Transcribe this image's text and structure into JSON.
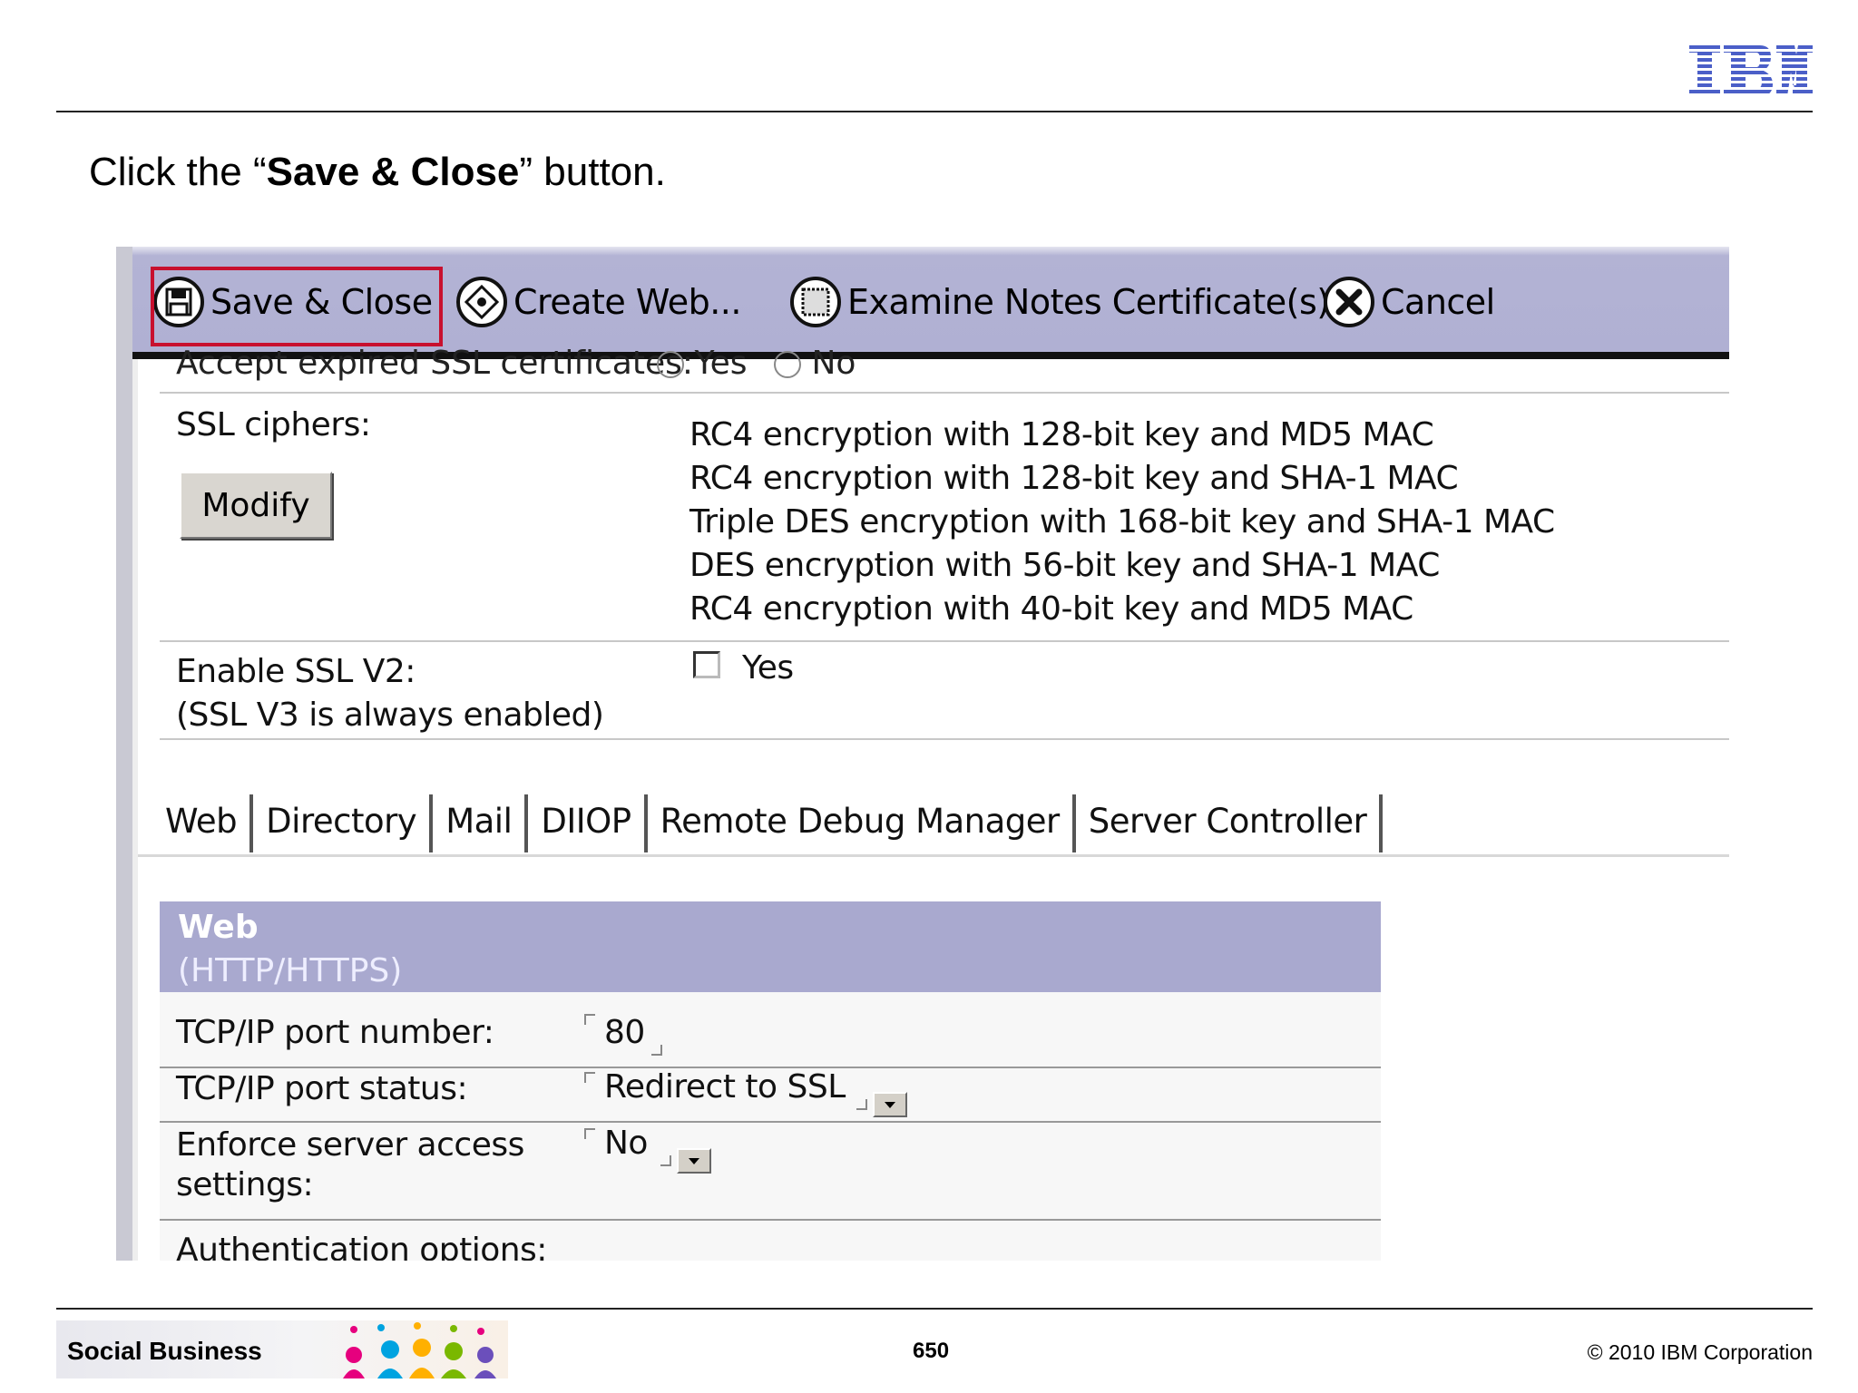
{
  "slide": {
    "instruction_prefix": "Click the “",
    "instruction_bold": "Save & Close",
    "instruction_suffix": "” button.",
    "logo_text": "IBM",
    "footer_label": "Social Business",
    "page_number": "650",
    "copyright": "© 2010 IBM Corporation"
  },
  "toolbar": {
    "buttons": [
      {
        "label": "Save & Close",
        "icon": "save-icon"
      },
      {
        "label": "Create Web...",
        "icon": "create-web-icon"
      },
      {
        "label": "Examine Notes Certificate(s)",
        "icon": "certificate-icon"
      },
      {
        "label": "Cancel",
        "icon": "cancel-icon"
      }
    ]
  },
  "form": {
    "clipped_label": "Accept expired SSL certificates:",
    "clipped_yes": "Yes",
    "clipped_no": "No",
    "ssl_ciphers_label": "SSL ciphers:",
    "modify_label": "Modify",
    "ciphers": [
      "RC4 encryption with 128-bit key and MD5 MAC",
      "RC4 encryption with 128-bit key and SHA-1 MAC",
      "Triple DES encryption with 168-bit key and SHA-1 MAC",
      "DES encryption with 56-bit key and SHA-1 MAC",
      "RC4 encryption with 40-bit key and MD5 MAC"
    ],
    "enable_ssl_v2_label": "Enable SSL V2:",
    "enable_ssl_v2_note": "(SSL V3 is always enabled)",
    "enable_ssl_v2_option": "Yes",
    "enable_ssl_v2_checked": false
  },
  "tabs": [
    "Web",
    "Directory",
    "Mail",
    "DIIOP",
    "Remote Debug Manager",
    "Server Controller"
  ],
  "web_section": {
    "title": "Web",
    "subtitle": "(HTTP/HTTPS)",
    "port_label": "TCP/IP port number:",
    "port_value": "80",
    "status_label": "TCP/IP port status:",
    "status_value": "Redirect to SSL",
    "enforce_label_line1": "Enforce server access",
    "enforce_label_line2": "settings:",
    "enforce_value": "No",
    "auth_label": "Authentication options:"
  },
  "colors": {
    "toolbar": "#b0b0d3",
    "section_header": "#a9a9cf",
    "highlight": "#c8102e",
    "ibm_blue": "#4b5fc8"
  }
}
